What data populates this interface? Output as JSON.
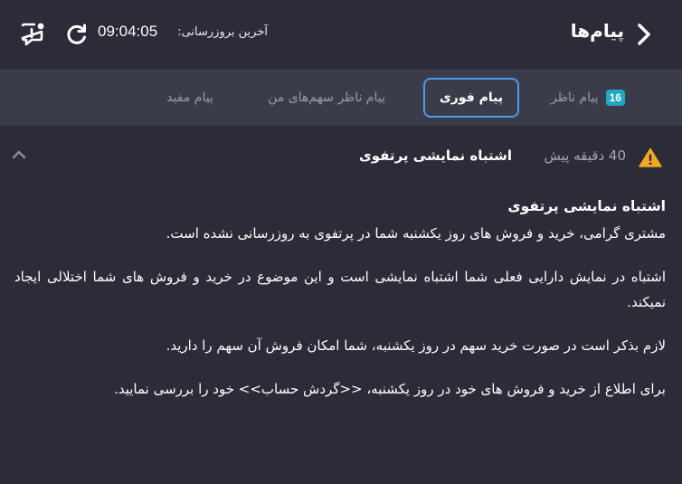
{
  "header": {
    "title": "پیام‌ها",
    "update_label": "آخرین بروزرسانی:",
    "update_time": "09:04:05"
  },
  "tabs": [
    {
      "label": "پیام ناظر",
      "badge": "16"
    },
    {
      "label": "پیام فوری"
    },
    {
      "label": "پیام ناظر سهم‌های من"
    },
    {
      "label": "پیام مفید"
    }
  ],
  "notification": {
    "time_ago": "40 دقیقه پیش",
    "title": "اشتباه نمایشی پرتفوی",
    "body_title": "اشتباه نمایشی پرتفوی",
    "paragraphs": [
      "مشتری گرامی، خرید و فروش های روز یکشنبه شما در پرتفوی به روزرسانی نشده است.",
      "اشتباه در نمایش دارایی فعلی شما اشتباه نمایشی است و این موضوع در خرید و فروش های شما اختلالی ایجاد نمیکند.",
      "لازم بذکر است در صورت خرید سهم در روز یکشنبه، شما امکان فروش آن سهم را دارید.",
      "برای اطلاع از خرید و فروش های خود در روز یکشنبه، <<گردش حساب>> خود را بررسی نمایید."
    ]
  },
  "icons": {
    "back": "chevron-right-icon",
    "refresh": "refresh-icon",
    "chat": "chat-alert-icon",
    "warning": "warning-icon",
    "collapse": "chevron-up-icon"
  },
  "colors": {
    "background": "#2b2c38",
    "tabs_bar": "#3b3c4a",
    "active_border": "#4b9af0",
    "badge": "#1fa8c4",
    "warning": "#f5a623"
  }
}
